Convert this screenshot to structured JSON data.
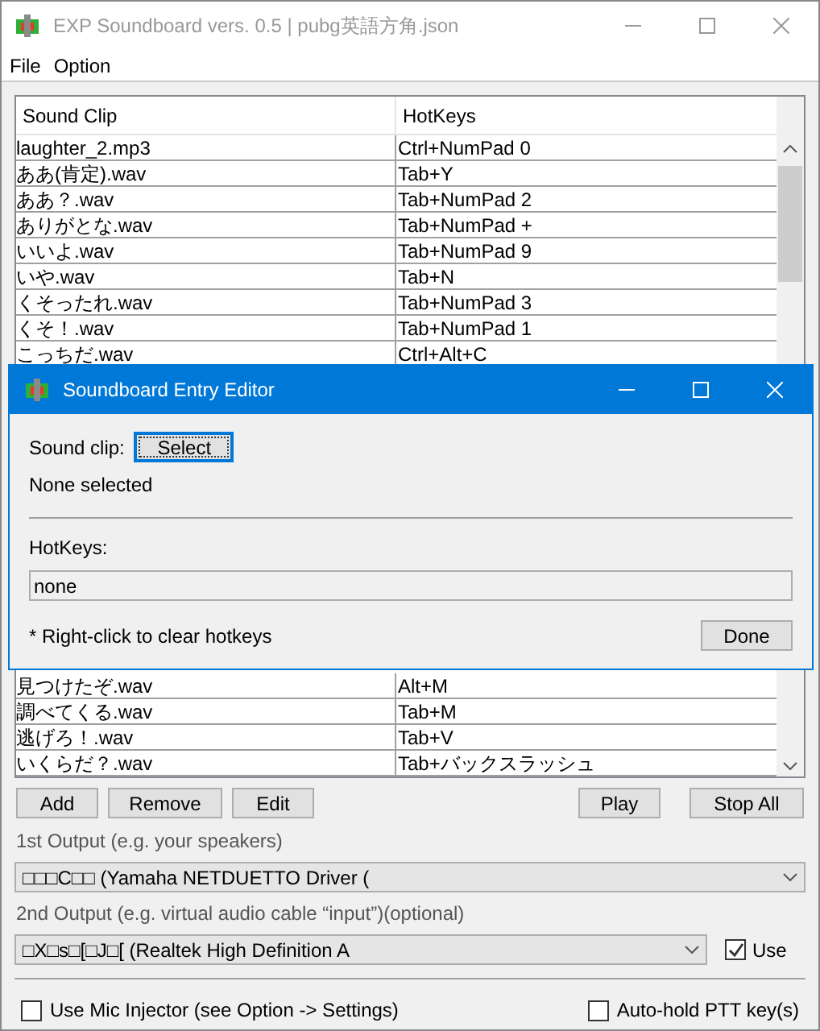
{
  "window": {
    "title": "EXP Soundboard vers. 0.5 | pubg英語方角.json"
  },
  "menu": [
    "File",
    "Option"
  ],
  "table": {
    "columns": [
      "Sound Clip",
      "HotKeys"
    ],
    "rows_top": [
      {
        "clip": "laughter_2.mp3",
        "hotkeys": "Ctrl+NumPad 0"
      },
      {
        "clip": "ああ(肯定).wav",
        "hotkeys": "Tab+Y"
      },
      {
        "clip": "ああ？.wav",
        "hotkeys": "Tab+NumPad 2"
      },
      {
        "clip": "ありがとな.wav",
        "hotkeys": "Tab+NumPad +"
      },
      {
        "clip": "いいよ.wav",
        "hotkeys": "Tab+NumPad 9"
      },
      {
        "clip": "いや.wav",
        "hotkeys": "Tab+N"
      },
      {
        "clip": "くそったれ.wav",
        "hotkeys": "Tab+NumPad 3"
      },
      {
        "clip": "くそ！.wav",
        "hotkeys": "Tab+NumPad 1"
      },
      {
        "clip": "こっちだ.wav",
        "hotkeys": "Ctrl+Alt+C"
      }
    ],
    "rows_bottom": [
      {
        "clip": "見つけたぞ.wav",
        "hotkeys": "Alt+M"
      },
      {
        "clip": "調べてくる.wav",
        "hotkeys": "Tab+M"
      },
      {
        "clip": "逃げろ！.wav",
        "hotkeys": "Tab+V"
      },
      {
        "clip": "いくらだ？.wav",
        "hotkeys": "Tab+バックスラッシュ"
      }
    ]
  },
  "buttons_left": [
    "Add",
    "Remove",
    "Edit"
  ],
  "buttons_right": [
    "Play",
    "Stop All"
  ],
  "output1": {
    "label": "1st Output (e.g. your speakers)",
    "value": "□□□C□□ (Yamaha NETDUETTO Driver ("
  },
  "output2": {
    "label": "2nd Output (e.g. virtual audio cable “input”)(optional)",
    "value": "□X□s□[□J□[ (Realtek High Definition A",
    "use_label": "Use",
    "use_checked": true
  },
  "options": [
    {
      "label": "Use Mic Injector (see Option -> Settings)",
      "checked": false
    },
    {
      "label": "Auto-hold PTT key(s)",
      "checked": false
    }
  ],
  "dialog": {
    "title": "Soundboard Entry Editor",
    "sound_clip_label": "Sound clip:",
    "select_button": "Select",
    "status": "None selected",
    "hotkeys_label": "HotKeys:",
    "hotkeys_value": "none",
    "note": "* Right-click to clear hotkeys",
    "done_button": "Done"
  }
}
